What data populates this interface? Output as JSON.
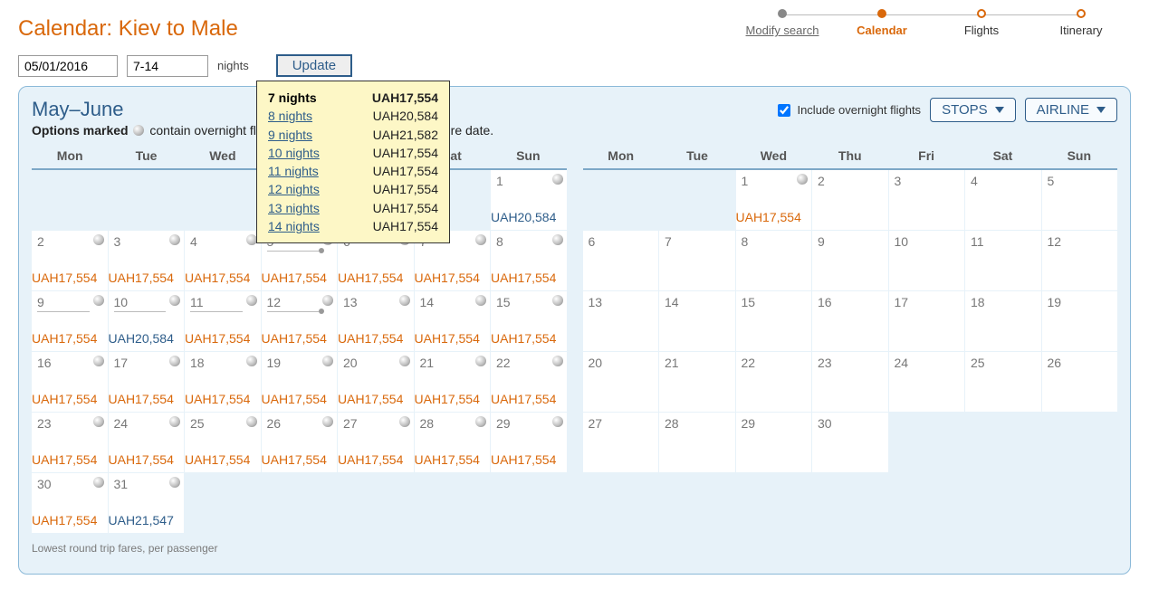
{
  "title": "Calendar: Kiev to Male",
  "steps": [
    {
      "label": "Modify search",
      "state": "done"
    },
    {
      "label": "Calendar",
      "state": "active"
    },
    {
      "label": "Flights",
      "state": "future"
    },
    {
      "label": "Itinerary",
      "state": "future"
    }
  ],
  "controls": {
    "date_value": "05/01/2016",
    "nights_value": "7-14",
    "nights_label": "nights",
    "update_label": "Update"
  },
  "panel": {
    "month_range": "May–June",
    "subnote_prefix": "Options marked",
    "subnote_suffix": "contain overnight flight(s). Month overview by departure date.",
    "include_label": "Include overnight flights",
    "include_checked": true,
    "stops_label": "STOPS",
    "airline_label": "AIRLINE",
    "footnote": "Lowest round trip fares, per passenger",
    "weekday_labels": [
      "Mon",
      "Tue",
      "Wed",
      "Thu",
      "Fri",
      "Sat",
      "Sun"
    ]
  },
  "tooltip": {
    "selected_index": 0,
    "rows": [
      {
        "nights": "7 nights",
        "price": "UAH17,554"
      },
      {
        "nights": "8 nights",
        "price": "UAH20,584"
      },
      {
        "nights": "9 nights",
        "price": "UAH21,582"
      },
      {
        "nights": "10 nights",
        "price": "UAH17,554"
      },
      {
        "nights": "11 nights",
        "price": "UAH17,554"
      },
      {
        "nights": "12 nights",
        "price": "UAH17,554"
      },
      {
        "nights": "13 nights",
        "price": "UAH17,554"
      },
      {
        "nights": "14 nights",
        "price": "UAH17,554"
      }
    ]
  },
  "left_cal": {
    "blanks_before": 6,
    "cells": [
      {
        "day": 1,
        "price": "UAH20,584",
        "color": "blue",
        "ind": true
      },
      {
        "day": 2,
        "price": "UAH17,554",
        "color": "orange",
        "ind": true
      },
      {
        "day": 3,
        "price": "UAH17,554",
        "color": "orange",
        "ind": true
      },
      {
        "day": 4,
        "price": "UAH17,554",
        "color": "orange",
        "ind": true
      },
      {
        "day": 5,
        "price": "UAH17,554",
        "color": "orange",
        "ind": true,
        "underline": true,
        "dot": true
      },
      {
        "day": 6,
        "price": "UAH17,554",
        "color": "orange",
        "ind": true
      },
      {
        "day": 7,
        "price": "UAH17,554",
        "color": "orange",
        "ind": true
      },
      {
        "day": 8,
        "price": "UAH17,554",
        "color": "orange",
        "ind": true
      },
      {
        "day": 9,
        "price": "UAH17,554",
        "color": "orange",
        "ind": true,
        "underline": true
      },
      {
        "day": 10,
        "price": "UAH20,584",
        "color": "blue",
        "ind": true,
        "underline": true
      },
      {
        "day": 11,
        "price": "UAH17,554",
        "color": "orange",
        "ind": true,
        "underline": true
      },
      {
        "day": 12,
        "price": "UAH17,554",
        "color": "orange",
        "ind": true,
        "underline": true,
        "dot": true
      },
      {
        "day": 13,
        "price": "UAH17,554",
        "color": "orange",
        "ind": true
      },
      {
        "day": 14,
        "price": "UAH17,554",
        "color": "orange",
        "ind": true
      },
      {
        "day": 15,
        "price": "UAH17,554",
        "color": "orange",
        "ind": true
      },
      {
        "day": 16,
        "price": "UAH17,554",
        "color": "orange",
        "ind": true
      },
      {
        "day": 17,
        "price": "UAH17,554",
        "color": "orange",
        "ind": true
      },
      {
        "day": 18,
        "price": "UAH17,554",
        "color": "orange",
        "ind": true
      },
      {
        "day": 19,
        "price": "UAH17,554",
        "color": "orange",
        "ind": true
      },
      {
        "day": 20,
        "price": "UAH17,554",
        "color": "orange",
        "ind": true
      },
      {
        "day": 21,
        "price": "UAH17,554",
        "color": "orange",
        "ind": true
      },
      {
        "day": 22,
        "price": "UAH17,554",
        "color": "orange",
        "ind": true
      },
      {
        "day": 23,
        "price": "UAH17,554",
        "color": "orange",
        "ind": true
      },
      {
        "day": 24,
        "price": "UAH17,554",
        "color": "orange",
        "ind": true
      },
      {
        "day": 25,
        "price": "UAH17,554",
        "color": "orange",
        "ind": true
      },
      {
        "day": 26,
        "price": "UAH17,554",
        "color": "orange",
        "ind": true
      },
      {
        "day": 27,
        "price": "UAH17,554",
        "color": "orange",
        "ind": true
      },
      {
        "day": 28,
        "price": "UAH17,554",
        "color": "orange",
        "ind": true
      },
      {
        "day": 29,
        "price": "UAH17,554",
        "color": "orange",
        "ind": true
      },
      {
        "day": 30,
        "price": "UAH17,554",
        "color": "orange",
        "ind": true
      },
      {
        "day": 31,
        "price": "UAH21,547",
        "color": "blue",
        "ind": true
      }
    ]
  },
  "right_cal": {
    "blanks_before": 2,
    "cells": [
      {
        "day": 1,
        "price": "UAH17,554",
        "color": "orange",
        "ind": true
      },
      {
        "day": 2
      },
      {
        "day": 3
      },
      {
        "day": 4
      },
      {
        "day": 5
      },
      {
        "day": 6
      },
      {
        "day": 7
      },
      {
        "day": 8
      },
      {
        "day": 9
      },
      {
        "day": 10
      },
      {
        "day": 11
      },
      {
        "day": 12
      },
      {
        "day": 13
      },
      {
        "day": 14
      },
      {
        "day": 15
      },
      {
        "day": 16
      },
      {
        "day": 17
      },
      {
        "day": 18
      },
      {
        "day": 19
      },
      {
        "day": 20
      },
      {
        "day": 21
      },
      {
        "day": 22
      },
      {
        "day": 23
      },
      {
        "day": 24
      },
      {
        "day": 25
      },
      {
        "day": 26
      },
      {
        "day": 27
      },
      {
        "day": 28
      },
      {
        "day": 29
      },
      {
        "day": 30
      }
    ]
  }
}
